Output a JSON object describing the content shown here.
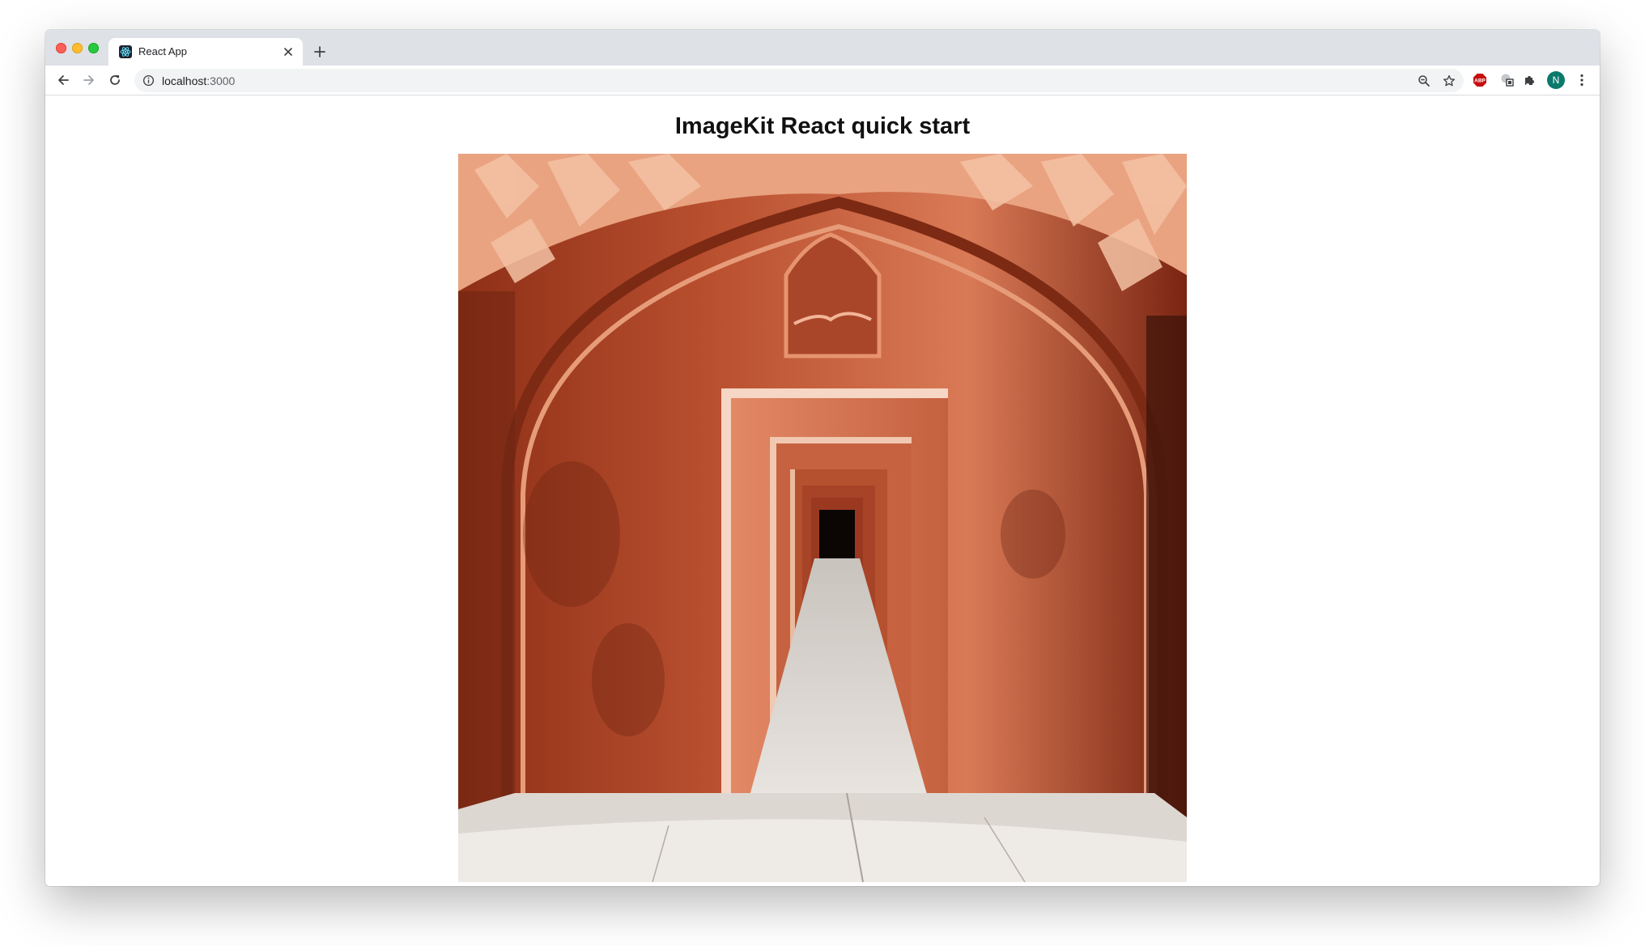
{
  "browser": {
    "tab": {
      "title": "React App",
      "favicon": "react-atom-icon"
    },
    "address_bar": {
      "host": "localhost",
      "port_suffix": ":3000"
    },
    "extensions": [
      {
        "name": "adblock-plus-icon",
        "label": "ABP"
      },
      {
        "name": "extension-puzzle-icon"
      },
      {
        "name": "profile-avatar",
        "initial": "N"
      }
    ],
    "colors": {
      "tabstrip": "#dee1e6",
      "omnibox": "#f1f3f4",
      "avatar": "#0b7a6c",
      "abp": "#c70d0d"
    }
  },
  "page": {
    "heading": "ImageKit React quick start",
    "image": {
      "description_icon": "archway-corridor-photo"
    }
  }
}
